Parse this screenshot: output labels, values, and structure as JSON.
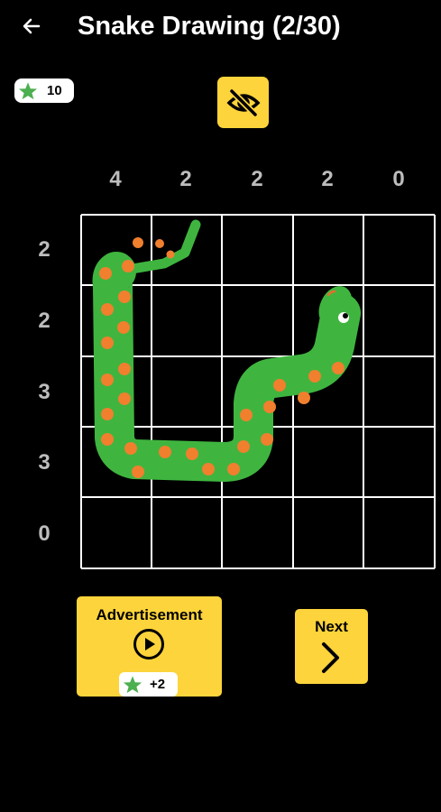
{
  "header": {
    "title": "Snake Drawing (2/30)",
    "back_icon": "arrow-left-icon"
  },
  "stars": {
    "count": "10",
    "icon": "star-icon",
    "color": "#4caf50"
  },
  "toolbar": {
    "hide_icon": "eye-off-icon"
  },
  "puzzle": {
    "column_clues": [
      "4",
      "2",
      "2",
      "2",
      "0"
    ],
    "row_clues": [
      "2",
      "2",
      "3",
      "3",
      "0"
    ],
    "grid_size": 5,
    "snake_cells": [
      [
        0,
        0
      ],
      [
        0,
        1
      ],
      [
        1,
        0
      ],
      [
        1,
        3
      ],
      [
        2,
        0
      ],
      [
        2,
        2
      ],
      [
        2,
        3
      ],
      [
        3,
        0
      ],
      [
        3,
        1
      ],
      [
        3,
        2
      ]
    ]
  },
  "advertisement": {
    "label": "Advertisement",
    "reward": "+2",
    "play_icon": "play-circle-icon",
    "star_icon": "star-icon"
  },
  "next": {
    "label": "Next",
    "icon": "chevron-right-icon"
  },
  "colors": {
    "accent": "#fdd43b",
    "snake_body": "#3fb53f",
    "snake_spots": "#f07f2e",
    "grid_lines": "#ffffff",
    "clue_text": "#bdbdbd"
  }
}
